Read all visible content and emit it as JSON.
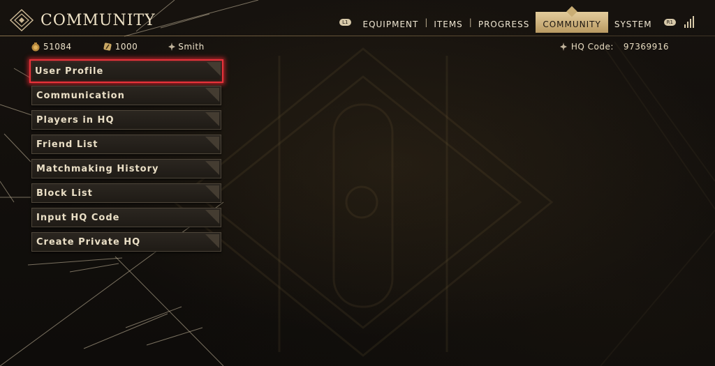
{
  "screen": {
    "title": "COMMUNITY",
    "title_icon": "diamond-emblem-icon"
  },
  "nav": {
    "left_button": "L1",
    "tabs": [
      "EQUIPMENT",
      "ITEMS",
      "PROGRESS",
      "COMMUNITY",
      "SYSTEM"
    ],
    "active_tab": "COMMUNITY",
    "right_button": "R1",
    "status_icon": "signal-bars-icon"
  },
  "stats": {
    "currency1": {
      "icon": "coin-pouch-icon",
      "value": "51084"
    },
    "currency2": {
      "icon": "ticket-icon",
      "value": "1000"
    },
    "player": {
      "icon": "player-sigil-icon",
      "name": "Smith"
    }
  },
  "hq": {
    "icon": "hq-sigil-icon",
    "label": "HQ Code:",
    "code": "97369916"
  },
  "menu": {
    "items": [
      {
        "label": "User Profile",
        "selected": true
      },
      {
        "label": "Communication",
        "selected": false
      },
      {
        "label": "Players in HQ",
        "selected": false
      },
      {
        "label": "Friend List",
        "selected": false
      },
      {
        "label": "Matchmaking History",
        "selected": false
      },
      {
        "label": "Block List",
        "selected": false
      },
      {
        "label": "Input HQ Code",
        "selected": false
      },
      {
        "label": "Create Private HQ",
        "selected": false
      }
    ]
  },
  "colors": {
    "accent_gold": "#c9ad74",
    "selection_red": "#e8323a",
    "text_light": "#eadfc6",
    "background": "#0d0b09"
  }
}
